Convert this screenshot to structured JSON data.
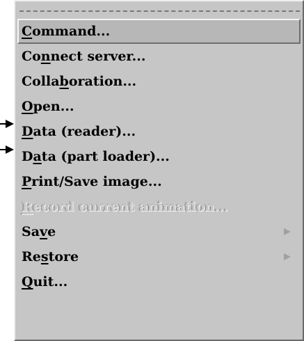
{
  "menu": {
    "items": [
      {
        "label": "Command...",
        "mnemonic_index": 0,
        "state": "active",
        "submenu": false
      },
      {
        "label": "Connect server...",
        "mnemonic_index": 2,
        "state": "normal",
        "submenu": false
      },
      {
        "label": "Collaboration...",
        "mnemonic_index": 5,
        "state": "normal",
        "submenu": false
      },
      {
        "label": "Open...",
        "mnemonic_index": 0,
        "state": "normal",
        "submenu": false
      },
      {
        "label": "Data (reader)...",
        "mnemonic_index": 0,
        "state": "normal",
        "submenu": false
      },
      {
        "label": "Data (part loader)...",
        "mnemonic_index": 1,
        "state": "normal",
        "submenu": false
      },
      {
        "label": "Print/Save image...",
        "mnemonic_index": 0,
        "state": "normal",
        "submenu": false
      },
      {
        "label": "Record current animation...",
        "mnemonic_index": 0,
        "state": "disabled",
        "submenu": false
      },
      {
        "label": "Save",
        "mnemonic_index": 2,
        "state": "normal",
        "submenu": true
      },
      {
        "label": "Restore",
        "mnemonic_index": 2,
        "state": "normal",
        "submenu": true
      },
      {
        "label": "Quit...",
        "mnemonic_index": 0,
        "state": "normal",
        "submenu": false
      }
    ]
  },
  "callouts": {
    "pointed_items": [
      "Open...",
      "Data (reader)..."
    ]
  },
  "colors": {
    "menu_background": "#c6c6c6",
    "active_background": "#b7b7b7",
    "text": "#000000",
    "submenu_arrow": "#a0a0a0"
  }
}
